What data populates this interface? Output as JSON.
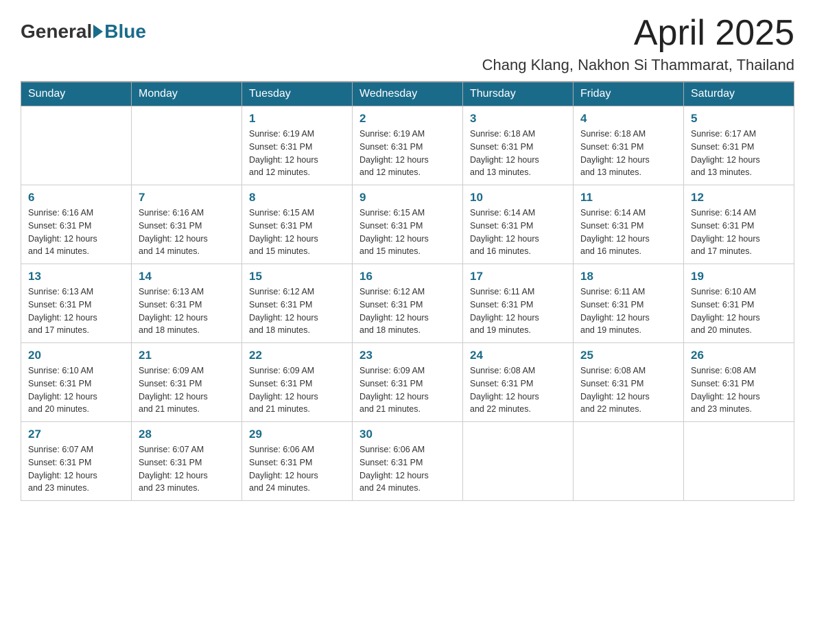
{
  "logo": {
    "general": "General",
    "blue": "Blue"
  },
  "title": {
    "month_year": "April 2025",
    "location": "Chang Klang, Nakhon Si Thammarat, Thailand"
  },
  "header_days": [
    "Sunday",
    "Monday",
    "Tuesday",
    "Wednesday",
    "Thursday",
    "Friday",
    "Saturday"
  ],
  "weeks": [
    [
      {
        "day": "",
        "info": ""
      },
      {
        "day": "",
        "info": ""
      },
      {
        "day": "1",
        "info": "Sunrise: 6:19 AM\nSunset: 6:31 PM\nDaylight: 12 hours\nand 12 minutes."
      },
      {
        "day": "2",
        "info": "Sunrise: 6:19 AM\nSunset: 6:31 PM\nDaylight: 12 hours\nand 12 minutes."
      },
      {
        "day": "3",
        "info": "Sunrise: 6:18 AM\nSunset: 6:31 PM\nDaylight: 12 hours\nand 13 minutes."
      },
      {
        "day": "4",
        "info": "Sunrise: 6:18 AM\nSunset: 6:31 PM\nDaylight: 12 hours\nand 13 minutes."
      },
      {
        "day": "5",
        "info": "Sunrise: 6:17 AM\nSunset: 6:31 PM\nDaylight: 12 hours\nand 13 minutes."
      }
    ],
    [
      {
        "day": "6",
        "info": "Sunrise: 6:16 AM\nSunset: 6:31 PM\nDaylight: 12 hours\nand 14 minutes."
      },
      {
        "day": "7",
        "info": "Sunrise: 6:16 AM\nSunset: 6:31 PM\nDaylight: 12 hours\nand 14 minutes."
      },
      {
        "day": "8",
        "info": "Sunrise: 6:15 AM\nSunset: 6:31 PM\nDaylight: 12 hours\nand 15 minutes."
      },
      {
        "day": "9",
        "info": "Sunrise: 6:15 AM\nSunset: 6:31 PM\nDaylight: 12 hours\nand 15 minutes."
      },
      {
        "day": "10",
        "info": "Sunrise: 6:14 AM\nSunset: 6:31 PM\nDaylight: 12 hours\nand 16 minutes."
      },
      {
        "day": "11",
        "info": "Sunrise: 6:14 AM\nSunset: 6:31 PM\nDaylight: 12 hours\nand 16 minutes."
      },
      {
        "day": "12",
        "info": "Sunrise: 6:14 AM\nSunset: 6:31 PM\nDaylight: 12 hours\nand 17 minutes."
      }
    ],
    [
      {
        "day": "13",
        "info": "Sunrise: 6:13 AM\nSunset: 6:31 PM\nDaylight: 12 hours\nand 17 minutes."
      },
      {
        "day": "14",
        "info": "Sunrise: 6:13 AM\nSunset: 6:31 PM\nDaylight: 12 hours\nand 18 minutes."
      },
      {
        "day": "15",
        "info": "Sunrise: 6:12 AM\nSunset: 6:31 PM\nDaylight: 12 hours\nand 18 minutes."
      },
      {
        "day": "16",
        "info": "Sunrise: 6:12 AM\nSunset: 6:31 PM\nDaylight: 12 hours\nand 18 minutes."
      },
      {
        "day": "17",
        "info": "Sunrise: 6:11 AM\nSunset: 6:31 PM\nDaylight: 12 hours\nand 19 minutes."
      },
      {
        "day": "18",
        "info": "Sunrise: 6:11 AM\nSunset: 6:31 PM\nDaylight: 12 hours\nand 19 minutes."
      },
      {
        "day": "19",
        "info": "Sunrise: 6:10 AM\nSunset: 6:31 PM\nDaylight: 12 hours\nand 20 minutes."
      }
    ],
    [
      {
        "day": "20",
        "info": "Sunrise: 6:10 AM\nSunset: 6:31 PM\nDaylight: 12 hours\nand 20 minutes."
      },
      {
        "day": "21",
        "info": "Sunrise: 6:09 AM\nSunset: 6:31 PM\nDaylight: 12 hours\nand 21 minutes."
      },
      {
        "day": "22",
        "info": "Sunrise: 6:09 AM\nSunset: 6:31 PM\nDaylight: 12 hours\nand 21 minutes."
      },
      {
        "day": "23",
        "info": "Sunrise: 6:09 AM\nSunset: 6:31 PM\nDaylight: 12 hours\nand 21 minutes."
      },
      {
        "day": "24",
        "info": "Sunrise: 6:08 AM\nSunset: 6:31 PM\nDaylight: 12 hours\nand 22 minutes."
      },
      {
        "day": "25",
        "info": "Sunrise: 6:08 AM\nSunset: 6:31 PM\nDaylight: 12 hours\nand 22 minutes."
      },
      {
        "day": "26",
        "info": "Sunrise: 6:08 AM\nSunset: 6:31 PM\nDaylight: 12 hours\nand 23 minutes."
      }
    ],
    [
      {
        "day": "27",
        "info": "Sunrise: 6:07 AM\nSunset: 6:31 PM\nDaylight: 12 hours\nand 23 minutes."
      },
      {
        "day": "28",
        "info": "Sunrise: 6:07 AM\nSunset: 6:31 PM\nDaylight: 12 hours\nand 23 minutes."
      },
      {
        "day": "29",
        "info": "Sunrise: 6:06 AM\nSunset: 6:31 PM\nDaylight: 12 hours\nand 24 minutes."
      },
      {
        "day": "30",
        "info": "Sunrise: 6:06 AM\nSunset: 6:31 PM\nDaylight: 12 hours\nand 24 minutes."
      },
      {
        "day": "",
        "info": ""
      },
      {
        "day": "",
        "info": ""
      },
      {
        "day": "",
        "info": ""
      }
    ]
  ]
}
